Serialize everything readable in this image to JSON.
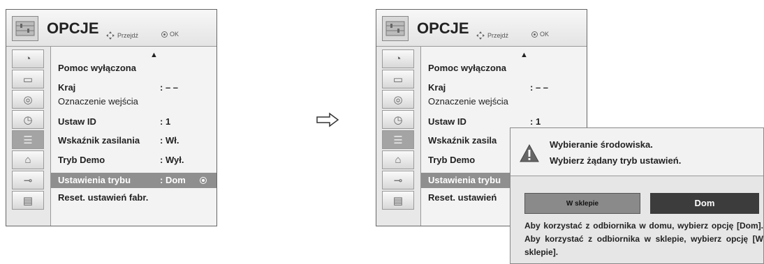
{
  "menu_title": "OPCJE",
  "hint_nav": "Przejdź",
  "hint_ok": "OK",
  "up_arrow": "▲",
  "rows": [
    {
      "label": "Pomoc wyłączona",
      "value": ""
    },
    {
      "label": "Kraj",
      "value": ": – –"
    },
    {
      "label": "Oznaczenie wejścia",
      "value": ""
    },
    {
      "label": "Ustaw ID",
      "value": ": 1"
    },
    {
      "label": "Wskaźnik zasilania",
      "value": ": Wł."
    },
    {
      "label": "Tryb Demo",
      "value": ": Wył."
    },
    {
      "label": "Ustawienia trybu",
      "value": ": Dom"
    },
    {
      "label": "Reset. ustawień  fabr.",
      "value": ""
    }
  ],
  "right_rows": [
    {
      "label": "Pomoc wyłączona",
      "value": ""
    },
    {
      "label": "Kraj",
      "value": ": – –"
    },
    {
      "label": "Oznaczenie wejścia",
      "value": ""
    },
    {
      "label": "Ustaw ID",
      "value": ": 1"
    },
    {
      "label": "Wskaźnik zasila",
      "value": ""
    },
    {
      "label": "Tryb Demo",
      "value": ""
    },
    {
      "label": "Ustawienia trybu",
      "value": ""
    },
    {
      "label": "Reset. ustawień",
      "value": ""
    }
  ],
  "sidebar_icons": [
    "satellite-dish-icon",
    "monitor-icon",
    "speaker-icon",
    "clock-icon",
    "options-icon",
    "lock-icon",
    "input-plug-icon",
    "media-icon"
  ],
  "active_icon_index": 4,
  "dialog": {
    "line1": "Wybieranie środowiska.",
    "line2": "Wybierz żądany tryb ustawień.",
    "btn_shop": "W sklepie",
    "btn_home": "Dom",
    "description": "Aby korzystać z odbiornika w domu, wybierz opcję [Dom]. Aby korzystać z odbiornika w sklepie, wybierz opcję [W sklepie]."
  },
  "colors": {
    "highlight": "#8f8f8f",
    "home_button": "#3c3c3c",
    "shop_button": "#8a8a8a"
  }
}
